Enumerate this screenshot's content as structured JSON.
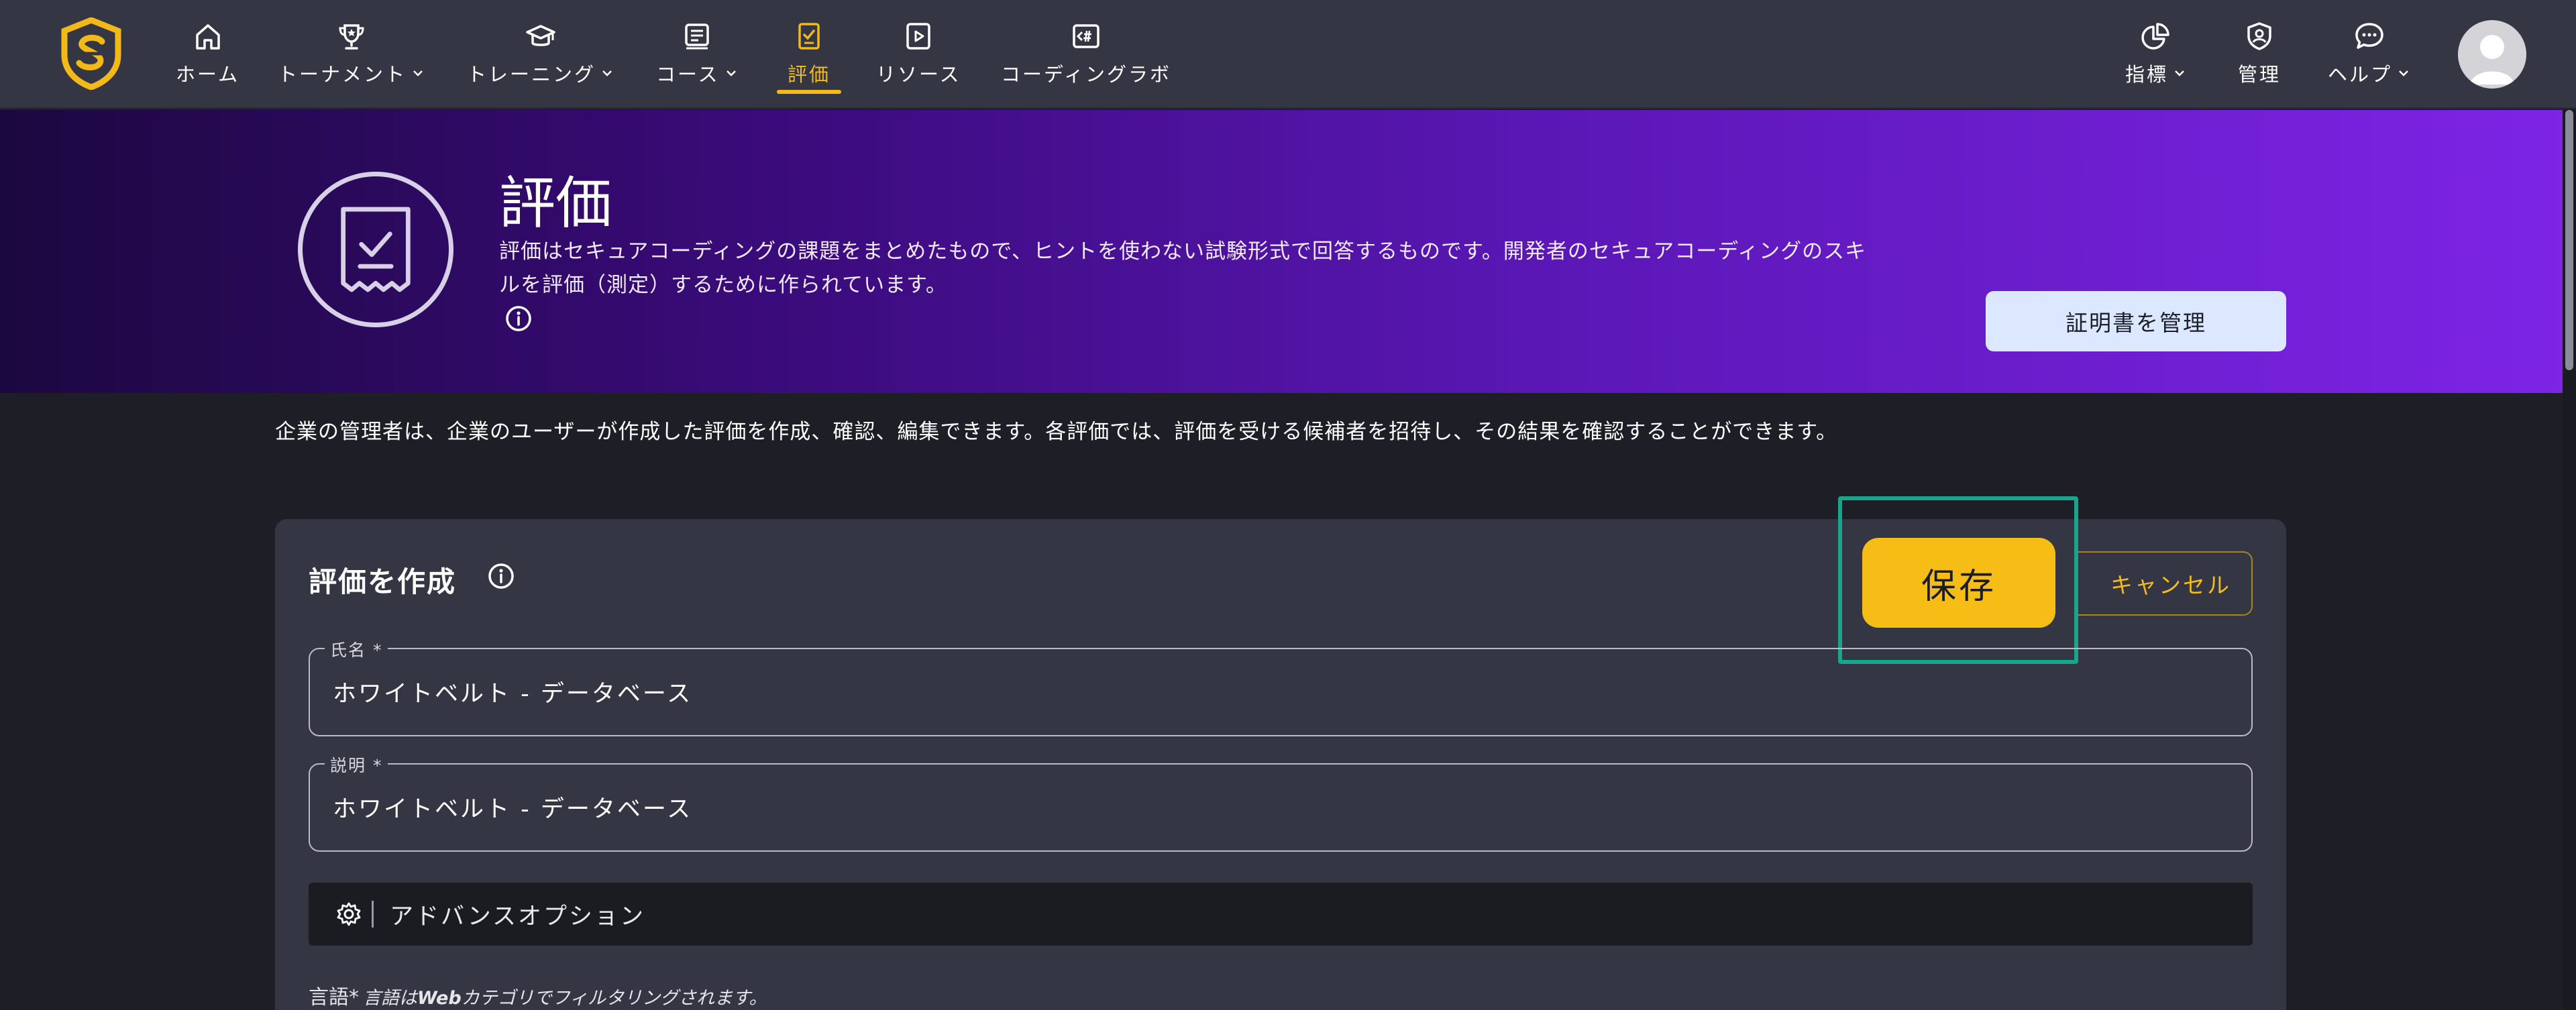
{
  "colors": {
    "accent": "#f2b919",
    "nav_bg": "#343644",
    "page_bg": "#1e1f26",
    "save_frame": "#17a58c"
  },
  "nav": {
    "home": "ホーム",
    "tournaments": "トーナメント",
    "training": "トレーニング",
    "courses": "コース",
    "assessments": "評価",
    "resources": "リソース",
    "coding_lab": "コーディングラボ",
    "metrics": "指標",
    "admin": "管理",
    "help": "ヘルプ"
  },
  "hero": {
    "title": "評価",
    "description": "評価はセキュアコーディングの課題をまとめたもので、ヒントを使わない試験形式で回答するものです。開発者のセキュアコーディングのスキルを評価（測定）するために作られています。",
    "cert_button": "証明書を管理"
  },
  "admin_note": "企業の管理者は、企業のユーザーが作成した評価を作成、確認、編集できます。各評価では、評価を受ける候補者を招待し、その結果を確認することができます。",
  "form": {
    "title": "評価を作成",
    "save_label": "保存",
    "cancel_label": "キャンセル",
    "name_label": "氏名 *",
    "name_value": "ホワイトベルト - データベース",
    "desc_label": "説明 *",
    "desc_value": "ホワイトベルト - データベース",
    "advanced_label": "アドバンスオプション",
    "language_label": "言語*",
    "language_hint_prefix": "言語は",
    "language_hint_bold": "Web",
    "language_hint_suffix": "カテゴリでフィルタリングされます。"
  }
}
